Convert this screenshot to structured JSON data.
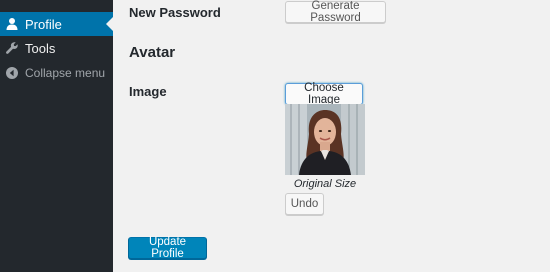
{
  "sidebar": {
    "items": [
      {
        "label": "Profile",
        "icon": "user-icon",
        "current": true
      },
      {
        "label": "Tools",
        "icon": "wrench-icon",
        "current": false
      },
      {
        "label": "Collapse menu",
        "icon": "collapse-arrow-icon",
        "current": false
      }
    ]
  },
  "form": {
    "new_password_label": "New Password",
    "generate_password_button": "Generate Password",
    "avatar_section_title": "Avatar",
    "image_label": "Image",
    "choose_image_button": "Choose Image",
    "avatar_caption": "Original Size",
    "undo_button": "Undo",
    "update_profile_button": "Update Profile"
  },
  "colors": {
    "sidebar_bg": "#23282d",
    "current_menu_bg": "#0073aa",
    "primary_button": "#0085ba",
    "page_bg": "#f1f1f1"
  }
}
